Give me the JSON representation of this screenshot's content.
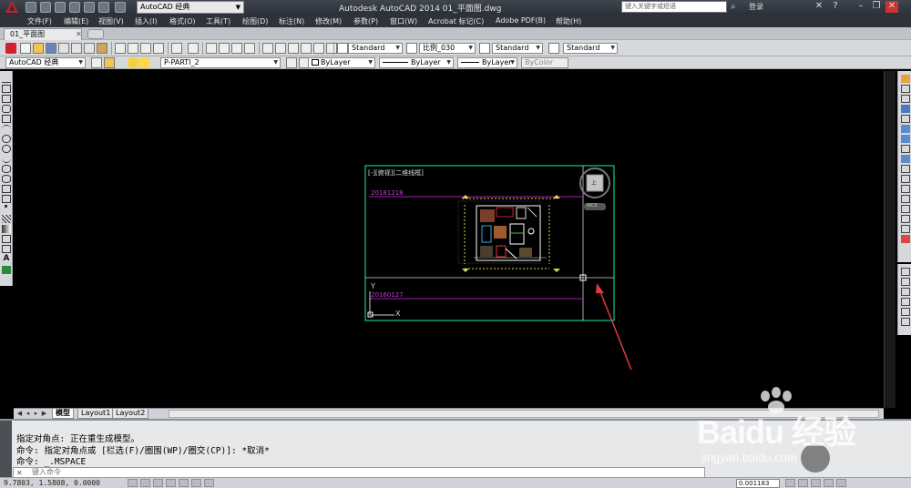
{
  "titlebar": {
    "workspace": "AutoCAD 经典",
    "window_title": "Autodesk AutoCAD 2014   01_平面图.dwg",
    "search_placeholder": "键入关键字或短语",
    "signin": "登录"
  },
  "menu": [
    "文件(F)",
    "编辑(E)",
    "视图(V)",
    "插入(I)",
    "格式(O)",
    "工具(T)",
    "绘图(D)",
    "标注(N)",
    "修改(M)",
    "参数(P)",
    "窗口(W)",
    "Acrobat 标记(C)",
    "Adobe PDF(B)",
    "帮助(H)"
  ],
  "doc_tab": {
    "label": "01_平面图"
  },
  "toolbar1": {
    "text_style": "Standard",
    "dim_style": "Standard",
    "dim_scale": "比例_030",
    "table_style": "Standard",
    "multileader_style": "Standard"
  },
  "toolbar2": {
    "workspace": "AutoCAD 经典",
    "layer": "P-PARTI_2",
    "color": "ByLayer",
    "linetype": "ByLayer",
    "lineweight": "ByLayer",
    "plotstyle": "ByColor"
  },
  "canvas": {
    "viewport_title": "[-][俯视][二维线框]",
    "label_top": "20181218",
    "label_bottom": "20160127",
    "ucs_y": "Y",
    "ucs_x": "X",
    "viewcube_top": "上",
    "wcs_label": "WCS"
  },
  "layout_tabs": [
    "模型",
    "Layout1",
    "Layout2"
  ],
  "command": {
    "lines": [
      "指定对角点: 正在重生成模型。",
      "命令: 指定对角点或 [栏选(F)/圈围(WP)/圈交(CP)]: *取消*",
      "命令: _.MSPACE"
    ],
    "input_placeholder": "键入命令"
  },
  "status": {
    "coords": "9.7803, 1.5808, 0.0000",
    "scale": "0.001183"
  },
  "watermark": {
    "brand": "Baidu 经验",
    "url": "jingyan.baidu.com"
  },
  "colors": {
    "viewport_border": "#10c894",
    "purple_line": "#a01fb0",
    "arrow_red": "#e23a3a"
  }
}
